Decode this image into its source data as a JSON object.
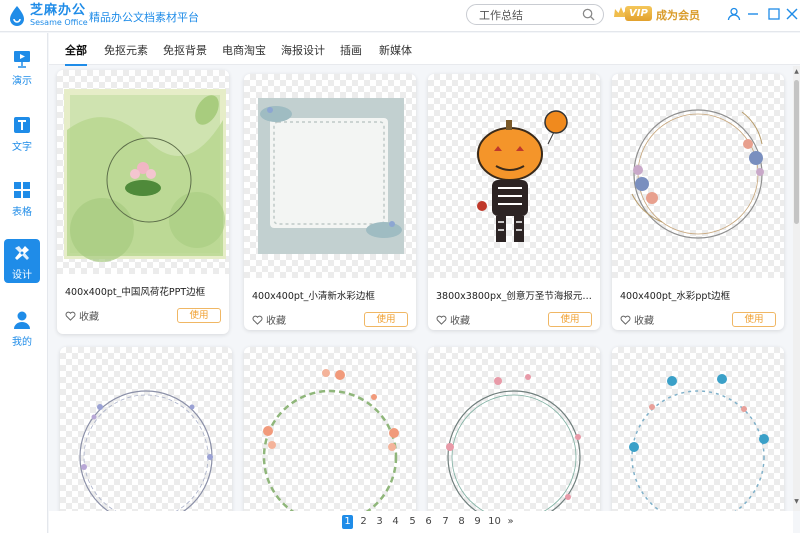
{
  "app": {
    "brand_cn": "芝麻办公",
    "brand_en": "Sesame Office",
    "tagline": "精品办公文档素材平台"
  },
  "search": {
    "value": "工作总结",
    "placeholder": "工作总结"
  },
  "vip": {
    "badge": "VIP",
    "label": "成为会员"
  },
  "sidebar": {
    "items": [
      {
        "label": "演示",
        "icon": "presentation-icon"
      },
      {
        "label": "文字",
        "icon": "text-doc-icon"
      },
      {
        "label": "表格",
        "icon": "table-icon"
      },
      {
        "label": "设计",
        "icon": "design-tools-icon",
        "active": true
      },
      {
        "label": "我的",
        "icon": "user-icon"
      }
    ]
  },
  "tabs": [
    {
      "label": "全部",
      "active": true
    },
    {
      "label": "免抠元素"
    },
    {
      "label": "免抠背景"
    },
    {
      "label": "电商淘宝"
    },
    {
      "label": "海报设计"
    },
    {
      "label": "插画"
    },
    {
      "label": "新媒体"
    }
  ],
  "cards": [
    {
      "title": "400x400pt_中国风荷花PPT边框",
      "fav": "收藏",
      "use": "使用"
    },
    {
      "title": "400x400pt_小清新水彩边框",
      "fav": "收藏",
      "use": "使用"
    },
    {
      "title": "3800x3800px_创意万圣节海报元素原创插画...",
      "fav": "收藏",
      "use": "使用"
    },
    {
      "title": "400x400pt_水彩ppt边框",
      "fav": "收藏",
      "use": "使用"
    },
    {
      "title": "",
      "fav": "",
      "use": ""
    },
    {
      "title": "",
      "fav": "",
      "use": ""
    },
    {
      "title": "",
      "fav": "",
      "use": ""
    },
    {
      "title": "",
      "fav": "",
      "use": ""
    }
  ],
  "pagination": {
    "pages": [
      "1",
      "2",
      "3",
      "4",
      "5",
      "6",
      "7",
      "8",
      "9",
      "10"
    ],
    "current": "1",
    "next": "»"
  },
  "colors": {
    "accent": "#1f8ce8",
    "vip_gold": "#e2a12c",
    "use_button": "#f0a030"
  }
}
